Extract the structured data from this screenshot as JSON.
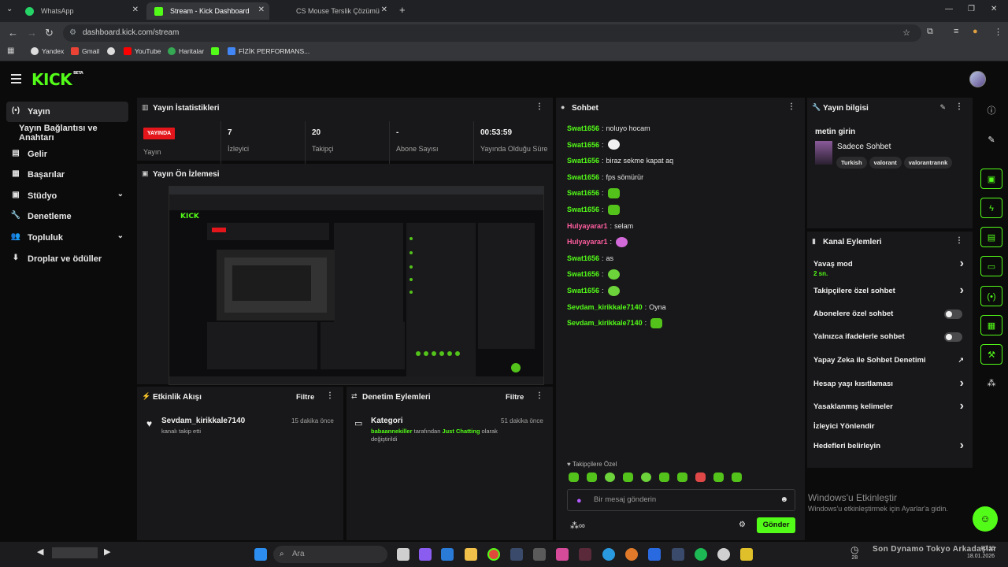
{
  "browser": {
    "tabs": [
      {
        "title": "WhatsApp",
        "color": "#25d366"
      },
      {
        "title": "Stream - Kick Dashboard",
        "color": "#53fc18"
      },
      {
        "title": "CS Mouse Terslik Çözümü",
        "color": "#ffffff"
      }
    ],
    "address": "dashboard.kick.com/stream",
    "bookmarks": [
      "Yandex",
      "Gmail",
      "YouTube",
      "Haritalar",
      "FİZİK PERFORMANS..."
    ]
  },
  "kick": {
    "logo": "KICK",
    "badge": "BETA",
    "accent": "#53fc18"
  },
  "left_nav": [
    {
      "label": "Yayın",
      "icon": "broadcast-icon"
    },
    {
      "label": "Yayın Bağlantısı ve Anahtarı",
      "icon": ""
    },
    {
      "label": "Gelir",
      "icon": "revenue-icon"
    },
    {
      "label": "Başarılar",
      "icon": "achievements-icon"
    },
    {
      "label": "Stüdyo",
      "icon": "studio-icon"
    },
    {
      "label": "Denetleme",
      "icon": "moderation-icon"
    },
    {
      "label": "Topluluk",
      "icon": "community-icon"
    },
    {
      "label": "Droplar ve ödüller",
      "icon": "drops-icon"
    }
  ],
  "stats": {
    "title": "Yayın İstatistikleri",
    "live_badge": "YAYINDA",
    "live_label": "Yayın",
    "cols": [
      {
        "value": "7",
        "label": "İzleyici"
      },
      {
        "value": "20",
        "label": "Takipçi"
      },
      {
        "value": "-",
        "label": "Abone Sayısı"
      },
      {
        "value": "00:53:59",
        "label": "Yayında Olduğu Süre"
      }
    ]
  },
  "preview": {
    "title": "Yayın Ön İzlemesi"
  },
  "activity": {
    "title": "Etkinlik Akışı",
    "filter": "Filtre",
    "item": {
      "name": "Sevdam_kirikkale7140",
      "sub": "kanalı takip etti",
      "time": "15 dakika önce"
    }
  },
  "mod_actions": {
    "title": "Denetim Eylemleri",
    "filter": "Filtre",
    "item": {
      "name": "Kategori",
      "actor": "babaannekiller",
      "mid": " tarafından ",
      "category": "Just Chatting",
      "tail": " olarak",
      "line2": "değiştirildi",
      "time": "51 dakika önce"
    }
  },
  "chat": {
    "title": "Sohbet",
    "messages": [
      {
        "user": "Swat1656",
        "color": "#53fc18",
        "text": "noluyo hocam",
        "emote": ""
      },
      {
        "user": "Swat1656",
        "color": "#53fc18",
        "text": "",
        "emote": "skull"
      },
      {
        "user": "Swat1656",
        "color": "#53fc18",
        "text": "biraz sekme kapat aq",
        "emote": ""
      },
      {
        "user": "Swat1656",
        "color": "#53fc18",
        "text": "fps sömürür",
        "emote": ""
      },
      {
        "user": "Swat1656",
        "color": "#53fc18",
        "text": "",
        "emote": "green"
      },
      {
        "user": "Swat1656",
        "color": "#53fc18",
        "text": "",
        "emote": "green"
      },
      {
        "user": "Hulyayarar1",
        "color": "#ff5ea0",
        "text": "selam",
        "emote": ""
      },
      {
        "user": "Hulyayarar1",
        "color": "#ff5ea0",
        "text": "",
        "emote": "pink"
      },
      {
        "user": "Swat1656",
        "color": "#53fc18",
        "text": "as",
        "emote": ""
      },
      {
        "user": "Swat1656",
        "color": "#53fc18",
        "text": "",
        "emote": "round"
      },
      {
        "user": "Swat1656",
        "color": "#53fc18",
        "text": "",
        "emote": "round"
      },
      {
        "user": "Sevdam_kirikkale7140",
        "color": "#53fc18",
        "text": "Oyna",
        "emote": ""
      },
      {
        "user": "Sevdam_kirikkale7140",
        "color": "#53fc18",
        "text": "",
        "emote": "green"
      }
    ],
    "followers_only": "Takipçilere Özel",
    "input_placeholder": "Bir mesaj gönderin",
    "send": "Gönder"
  },
  "stream_info": {
    "title": "Yayın bilgisi",
    "stream_title": "metin girin",
    "category": "Sadece Sohbet",
    "tags": [
      "Turkish",
      "valorant",
      "valorantrannk"
    ]
  },
  "channel_actions": {
    "title": "Kanal Eylemleri",
    "rows": [
      {
        "label": "Yavaş mod",
        "sub": "2 sn.",
        "control": "chevron"
      },
      {
        "label": "Takipçilere özel sohbet",
        "sub": "",
        "control": "chevron"
      },
      {
        "label": "Abonelere özel sohbet",
        "sub": "",
        "control": "toggle"
      },
      {
        "label": "Yalnızca ifadelerle sohbet",
        "sub": "",
        "control": "toggle"
      },
      {
        "label": "Yapay Zeka ile Sohbet Denetimi",
        "sub": "",
        "control": "external"
      },
      {
        "label": "Hesap yaşı kısıtlaması",
        "sub": "",
        "control": "chevron"
      },
      {
        "label": "Yasaklanmış kelimeler",
        "sub": "",
        "control": "chevron"
      },
      {
        "label": "İzleyici Yönlendir",
        "sub": "",
        "control": ""
      },
      {
        "label": "Hedefleri belirleyin",
        "sub": "",
        "control": "chevron"
      }
    ]
  },
  "windows": {
    "activate_title": "Windows'u Etkinleştir",
    "activate_sub": "Windows'u etkinleştirmek için Ayarlar'a gidin."
  },
  "taskbar": {
    "search": "Ara",
    "now_playing": "Son Dynamo Tokyo Arkadaşlar",
    "time": "00:18",
    "date": "18.01.2026",
    "widget_temp": "28"
  }
}
